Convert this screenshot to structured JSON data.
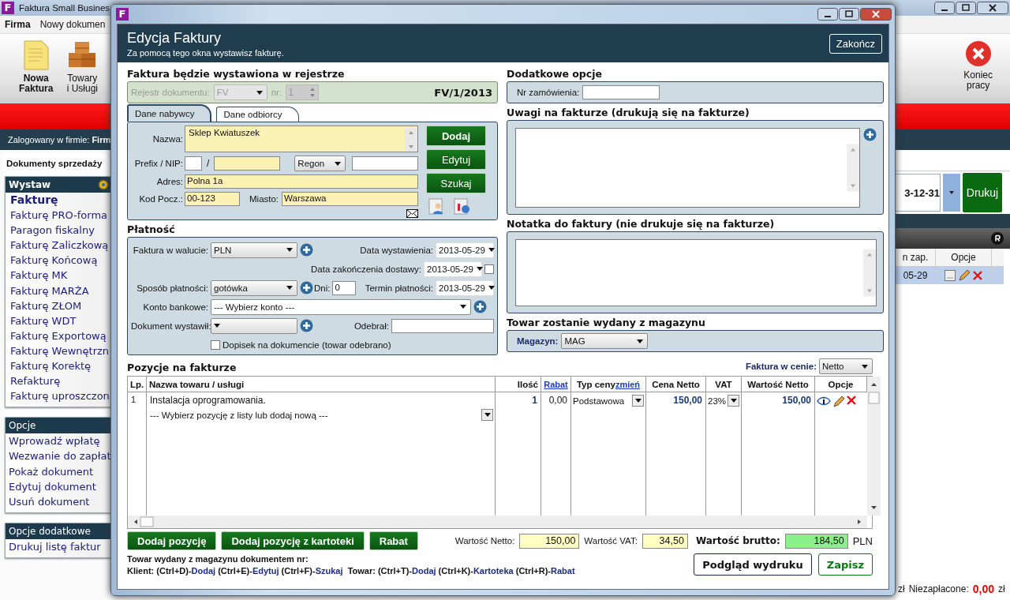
{
  "app": {
    "logo": "F",
    "title": "Faktura Small Busines",
    "menu": [
      {
        "label": "Firma",
        "selected": true
      },
      {
        "label": "Nowy dokumen",
        "selected": false
      }
    ],
    "toolbar": [
      {
        "lines": [
          "Nowa",
          "Faktura"
        ],
        "kind": "invoice",
        "selected": true
      },
      {
        "lines": [
          "Towary",
          "i Usługi"
        ],
        "kind": "goods",
        "selected": false
      }
    ],
    "exit_button": {
      "lines": [
        "Koniec",
        "pracy"
      ]
    },
    "login": {
      "label": "Zalogowany w firmie:",
      "company": "Firm"
    },
    "section_tab": "Dokumenty sprzedaży",
    "sidebar": [
      {
        "title": "Wystaw",
        "kind": "main",
        "items": [
          {
            "label": "Fakturę",
            "selected": true
          },
          {
            "label": "Fakturę PRO-forma",
            "selected": false
          },
          {
            "label": "Paragon fiskalny",
            "selected": false
          },
          {
            "label": "Fakturę Zaliczkową",
            "selected": false
          },
          {
            "label": "Fakturę Końcową",
            "selected": false
          },
          {
            "label": "Fakturę MK",
            "selected": false
          },
          {
            "label": "Fakturę MARŻA",
            "selected": false
          },
          {
            "label": "Fakturę ZŁOM",
            "selected": false
          },
          {
            "label": "Fakturę WDT",
            "selected": false
          },
          {
            "label": "Fakturę Exportową",
            "selected": false
          },
          {
            "label": "Fakturę Wewnętrzn",
            "selected": false
          },
          {
            "label": "Fakturę Korektę",
            "selected": false
          },
          {
            "label": "Refakturę",
            "selected": false
          },
          {
            "label": "Fakturę uproszczon",
            "selected": false
          }
        ]
      },
      {
        "title": "Opcje",
        "kind": "plain",
        "items": [
          {
            "label": "Wprowadź wpłatę",
            "selected": false
          },
          {
            "label": "Wezwanie do zapłat",
            "selected": false
          },
          {
            "label": "Pokaż dokument",
            "selected": false
          },
          {
            "label": "Edytuj dokument",
            "selected": false
          },
          {
            "label": "Usuń dokument",
            "selected": false
          }
        ]
      },
      {
        "title": "Opcje dodatkowe",
        "kind": "plain",
        "items": [
          {
            "label": "Drukuj listę faktur",
            "selected": false
          }
        ]
      }
    ],
    "list_panel": {
      "date_to": "3-12-31",
      "print_button": "Drukuj",
      "columns": [
        "n zap.",
        "Opcje"
      ],
      "rows": [
        {
          "cells": [
            "05-29"
          ],
          "selected": true
        }
      ],
      "footer_currency": "zł",
      "unpaid_label": "Niezapłacone:",
      "unpaid_value": "0,00",
      "unpaid_currency": "zł"
    }
  },
  "dialog": {
    "logo": "F",
    "header": {
      "title": "Edycja Faktury",
      "subtitle": "Za pomocą tego okna wystawisz fakturę.",
      "close_button": "Zakończ"
    },
    "register": {
      "heading": "Faktura będzie wystawiona w rejestrze",
      "register_label": "Rejestr dokumentu:",
      "register_value": "FV",
      "number_label": "nr:",
      "number_value": "1",
      "disabled": true,
      "document_number": "FV/1/2013"
    },
    "buyer_tabs": [
      {
        "label": "Dane nabywcy",
        "selected": true
      },
      {
        "label": "Dane odbiorcy",
        "selected": false
      }
    ],
    "buyer": {
      "name_label": "Nazwa:",
      "name": "Sklep Kwiatuszek",
      "nip_label": "Prefix / NIP:",
      "nip_separator": "/",
      "id_type": "Regon",
      "address_label": "Adres:",
      "address": "Polna 1a",
      "postcode_label": "Kod Pocz.:",
      "postcode": "00-123",
      "city_label": "Miasto:",
      "city": "Warszawa",
      "buttons": [
        {
          "label": "Dodaj",
          "default": true
        },
        {
          "label": "Edytuj",
          "default": false
        },
        {
          "label": "Szukaj",
          "default": false
        }
      ]
    },
    "payment": {
      "heading": "Płatność",
      "currency_label": "Faktura w walucie:",
      "currency": "PLN",
      "issue_date_label": "Data wystawienia:",
      "issue_date": "2013-05-29",
      "delivery_date_label": "Data zakończenia dostawy:",
      "delivery_date": "2013-05-29",
      "delivery_date_checked": false,
      "method_label": "Sposób płatności:",
      "method": "gotówka",
      "days_label": "Dni:",
      "days": "0",
      "due_label": "Termin płatności:",
      "due_date": "2013-05-29",
      "account_label": "Konto bankowe:",
      "account": "--- Wybierz konto ---",
      "issuer_label": "Dokument wystawił:",
      "receiver_label": "Odebrał:",
      "note_label": "Dopisek na dokumencie (towar odebrano)",
      "note_checked": false
    },
    "extra": {
      "heading": "Dodatkowe opcje",
      "order_label": "Nr zamówienia:"
    },
    "remarks": {
      "heading": "Uwagi na fakturze (drukują się na fakturze)"
    },
    "note": {
      "heading": "Notatka do faktury (nie drukuje się na fakturze)"
    },
    "warehouse": {
      "heading": "Towar zostanie wydany z magazynu",
      "label": "Magazyn:",
      "value": "MAG"
    },
    "items": {
      "heading": "Pozycje na fakturze",
      "price_mode_label": "Faktura w cenie:",
      "price_mode": "Netto",
      "columns": [
        {
          "label": "Lp."
        },
        {
          "label": "Nazwa towaru / usługi"
        },
        {
          "label": "Ilość"
        },
        {
          "link": "Rabat"
        },
        {
          "label": "Typ ceny",
          "link": "zmień"
        },
        {
          "label": "Cena Netto"
        },
        {
          "label": "VAT"
        },
        {
          "label": "Wartość Netto"
        },
        {
          "label": "Opcje"
        }
      ],
      "rows": [
        {
          "lp": "1",
          "name": "Instalacja oprogramowania.",
          "picker": "--- Wybierz pozycję z listy lub dodaj nową ---",
          "qty": "1",
          "discount": "0,00",
          "price_type": "Podstawowa",
          "net_price": "150,00",
          "vat": "23%",
          "net_value": "150,00"
        }
      ],
      "buttons": [
        "Dodaj pozycję",
        "Dodaj pozycję z kartoteki",
        "Rabat"
      ]
    },
    "totals": {
      "net_label": "Wartość Netto:",
      "net": "150,00",
      "vat_label": "Wartość VAT:",
      "vat": "34,50",
      "gross_label": "Wartość brutto:",
      "gross": "184,50",
      "currency": "PLN"
    },
    "footer": {
      "warehouse_doc": "Towar wydany z magazynu dokumentem nr:",
      "shortcuts": [
        {
          "text": "Klient: (Ctrl+D)-",
          "kind": "key"
        },
        {
          "text": "Dodaj",
          "kind": "action"
        },
        {
          "text": " (Ctrl+E)-",
          "kind": "key"
        },
        {
          "text": "Edytuj",
          "kind": "action"
        },
        {
          "text": " (Ctrl+F)-",
          "kind": "key"
        },
        {
          "text": "Szukaj",
          "kind": "action"
        },
        {
          "text": "  Towar: (Ctrl+T)-",
          "kind": "key"
        },
        {
          "text": "Dodaj",
          "kind": "action"
        },
        {
          "text": " (Ctrl+K)-",
          "kind": "key"
        },
        {
          "text": "Kartoteka",
          "kind": "action"
        },
        {
          "text": " (Ctrl+R)-",
          "kind": "key"
        },
        {
          "text": "Rabat",
          "kind": "action"
        }
      ],
      "preview_button": "Podgląd wydruku",
      "save_button": "Zapisz"
    }
  }
}
